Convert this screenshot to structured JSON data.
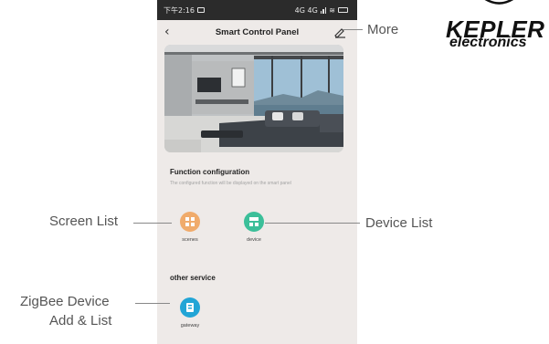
{
  "status_bar": {
    "time": "下午2:16",
    "signal": "4G 4G"
  },
  "navbar": {
    "title": "Smart Control Panel",
    "back_icon": "chevron-left-icon",
    "edit_icon": "edit-icon"
  },
  "function_configuration": {
    "title": "Function configuration",
    "description": "The configured function will be displayed on the smart panel",
    "items": [
      {
        "label": "scenes",
        "icon": "grid-icon",
        "color": "#f0ab6b"
      },
      {
        "label": "device",
        "icon": "device-panel-icon",
        "color": "#3bbf99"
      }
    ]
  },
  "other_service": {
    "title": "other service",
    "items": [
      {
        "label": "gateway",
        "icon": "gateway-icon",
        "color": "#22a5d6"
      }
    ]
  },
  "callouts": {
    "more": "More",
    "screen_list": "Screen List",
    "device_list": "Device List",
    "zigbee_line1": "ZigBee Device",
    "zigbee_line2": "Add & List"
  },
  "logo": {
    "name": "KEPLER",
    "sub": "electronics"
  }
}
